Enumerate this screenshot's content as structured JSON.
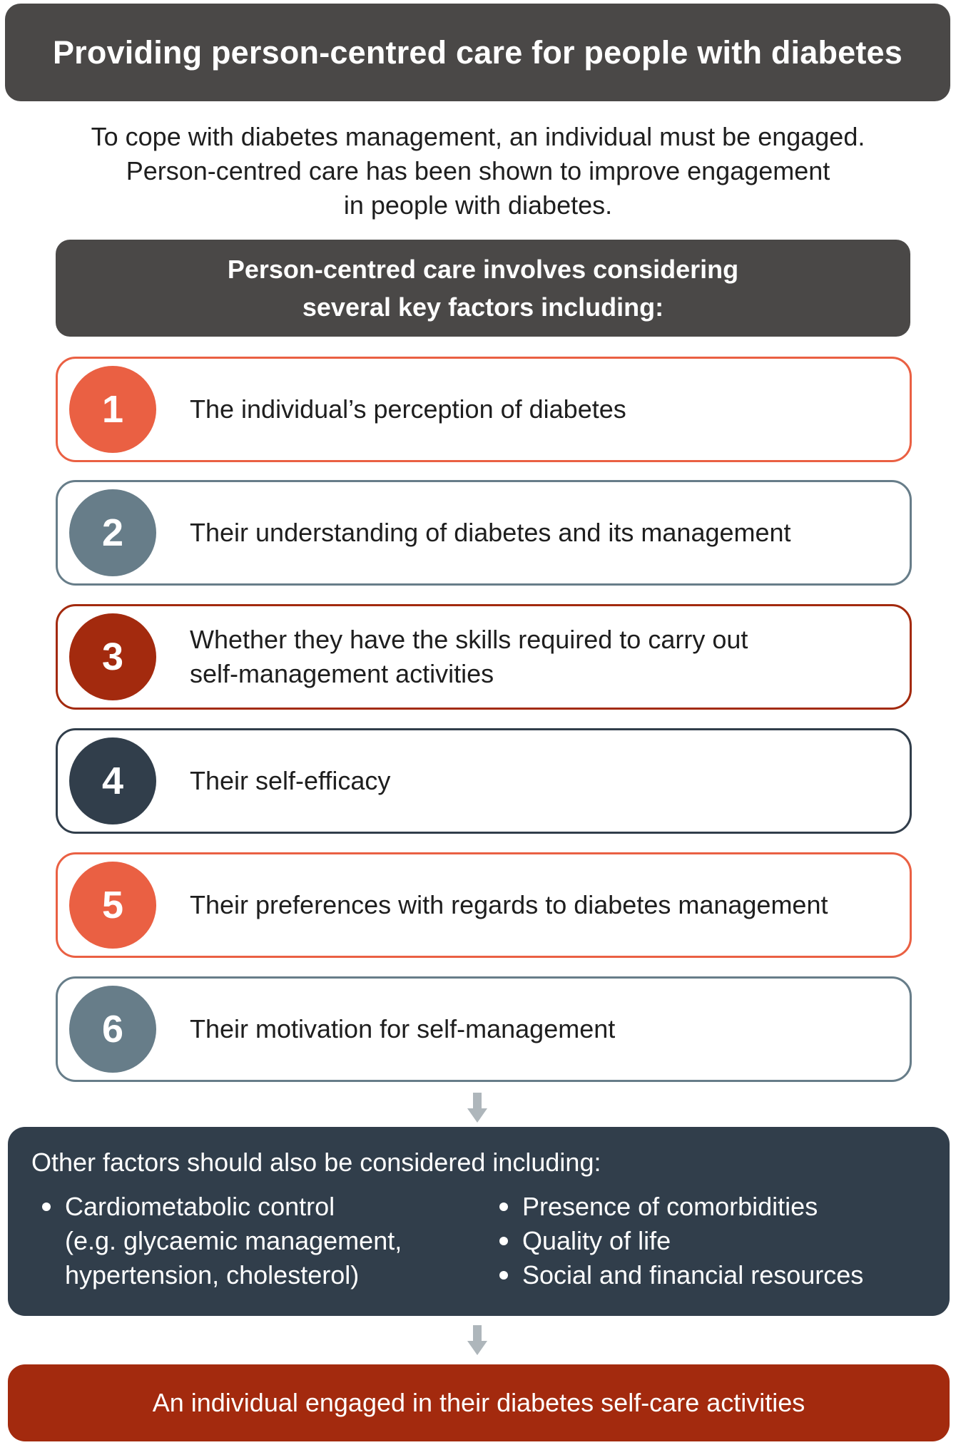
{
  "title": "Providing person-centred care for people with diabetes",
  "intro": [
    "To cope with diabetes management, an individual must be engaged.",
    "Person-centred care has been shown to improve engagement",
    "in people with diabetes."
  ],
  "key_factors_header": [
    "Person-centred care involves considering",
    "several key factors including:"
  ],
  "factors": [
    {
      "number": "1",
      "lines": [
        "The individual’s perception of diabetes"
      ],
      "color": "#ea6043"
    },
    {
      "number": "2",
      "lines": [
        "Their understanding of diabetes and its management"
      ],
      "color": "#677d89"
    },
    {
      "number": "3",
      "lines": [
        "Whether they have the skills required to carry out",
        "self-management activities"
      ],
      "color": "#a32a0e"
    },
    {
      "number": "4",
      "lines": [
        "Their self-efficacy"
      ],
      "color": "#313e4b"
    },
    {
      "number": "5",
      "lines": [
        "Their preferences with regards to diabetes management"
      ],
      "color": "#ea6043"
    },
    {
      "number": "6",
      "lines": [
        "Their motivation for self-management"
      ],
      "color": "#677d89"
    }
  ],
  "other_factors": {
    "heading": "Other factors should also be considered including:",
    "left_items": [
      {
        "lines": [
          "Cardiometabolic control",
          "(e.g. glycaemic management,",
          "hypertension, cholesterol)"
        ]
      }
    ],
    "right_items": [
      {
        "lines": [
          "Presence of comorbidities"
        ]
      },
      {
        "lines": [
          "Quality of life"
        ]
      },
      {
        "lines": [
          "Social and financial resources"
        ]
      }
    ]
  },
  "result": "An individual engaged in their diabetes self-care activities",
  "colors": {
    "dark_header": "#4a4847",
    "navy": "#313e4b",
    "orange": "#ea6043",
    "slate": "#677d89",
    "red": "#a32a0e",
    "arrow": "#aeb6bb"
  }
}
